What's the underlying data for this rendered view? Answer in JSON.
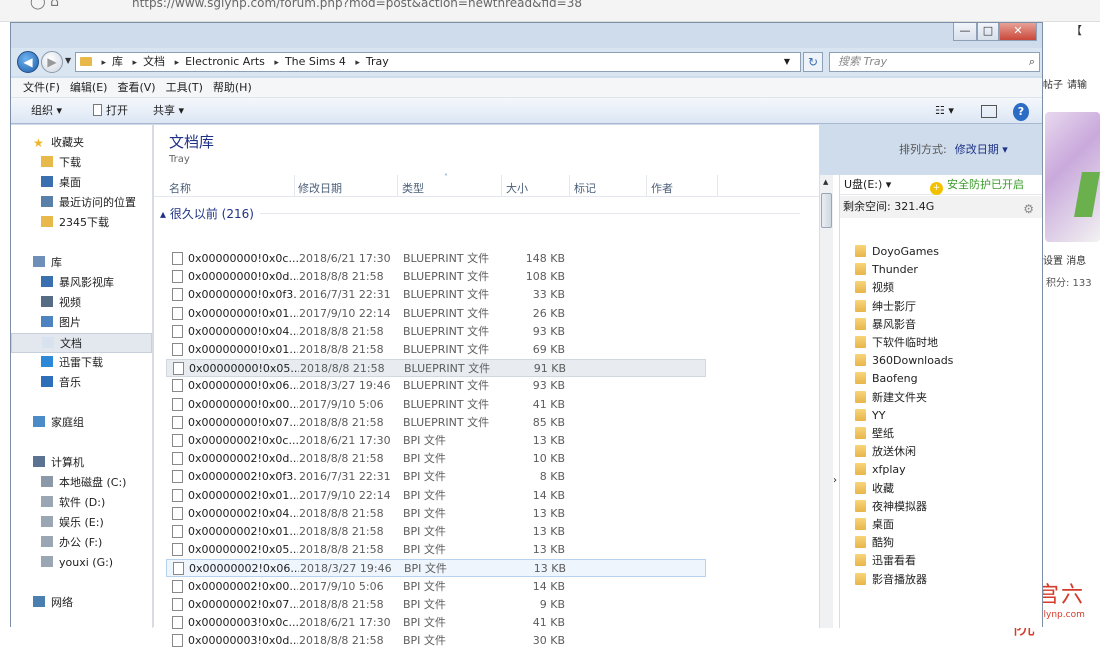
{
  "browser": {
    "url": "https://www.sglynp.com/forum.php?mod=post&action=newthread&fid=38"
  },
  "background_page": {
    "top_right": "【",
    "right_tabs": [
      "帖子",
      "请输"
    ],
    "links": [
      "设置",
      "消息"
    ],
    "points": "积分: 133"
  },
  "watermark": {
    "title": "三宫六院",
    "url": "www.sglynp.com"
  },
  "window": {
    "minimize": "—",
    "maximize": "□",
    "close": "✕"
  },
  "address": {
    "crumbs": [
      "库",
      "文档",
      "Electronic Arts",
      "The Sims 4",
      "Tray"
    ],
    "search_placeholder": "搜索 Tray"
  },
  "menu": [
    "文件(F)",
    "编辑(E)",
    "查看(V)",
    "工具(T)",
    "帮助(H)"
  ],
  "toolbar": {
    "organize": "组织 ▾",
    "open": "打开",
    "share": "共享 ▾"
  },
  "nav": [
    {
      "label": "收藏夹",
      "icon": "star-icon",
      "kind": "header"
    },
    {
      "label": "下载",
      "icon": "download-folder-icon",
      "kind": "item"
    },
    {
      "label": "桌面",
      "icon": "desktop-icon",
      "kind": "item"
    },
    {
      "label": "最近访问的位置",
      "icon": "recent-places-icon",
      "kind": "item"
    },
    {
      "label": "2345下载",
      "icon": "folder-icon",
      "kind": "item"
    },
    {
      "label": "库",
      "icon": "library-icon",
      "kind": "header"
    },
    {
      "label": "暴风影视库",
      "icon": "video-library-icon",
      "kind": "item"
    },
    {
      "label": "视频",
      "icon": "video-icon",
      "kind": "item"
    },
    {
      "label": "图片",
      "icon": "pictures-icon",
      "kind": "item"
    },
    {
      "label": "文档",
      "icon": "documents-icon",
      "kind": "item"
    },
    {
      "label": "迅雷下载",
      "icon": "thunder-icon",
      "kind": "item"
    },
    {
      "label": "音乐",
      "icon": "music-icon",
      "kind": "item"
    },
    {
      "label": "家庭组",
      "icon": "homegroup-icon",
      "kind": "header"
    },
    {
      "label": "计算机",
      "icon": "computer-icon",
      "kind": "header"
    },
    {
      "label": "本地磁盘 (C:)",
      "icon": "drive-c-icon",
      "kind": "item"
    },
    {
      "label": "软件 (D:)",
      "icon": "drive-icon",
      "kind": "item"
    },
    {
      "label": "娱乐 (E:)",
      "icon": "drive-icon",
      "kind": "item"
    },
    {
      "label": "办公 (F:)",
      "icon": "drive-icon",
      "kind": "item"
    },
    {
      "label": "youxi (G:)",
      "icon": "drive-icon",
      "kind": "item"
    },
    {
      "label": "网络",
      "icon": "network-icon",
      "kind": "header"
    }
  ],
  "library": {
    "title": "文档库",
    "subtitle": "Tray",
    "sort_label": "排列方式:",
    "sort_value": "修改日期 ▾"
  },
  "columns": [
    "名称",
    "修改日期",
    "类型",
    "大小",
    "标记",
    "作者"
  ],
  "group": "▴ 很久以前 (216)",
  "files": [
    {
      "name": "0x00000000!0x0c...",
      "date": "2018/6/21 17:30",
      "type": "BLUEPRINT 文件",
      "size": "148 KB"
    },
    {
      "name": "0x00000000!0x0d...",
      "date": "2018/8/8 21:58",
      "type": "BLUEPRINT 文件",
      "size": "108 KB"
    },
    {
      "name": "0x00000000!0x0f3...",
      "date": "2016/7/31 22:31",
      "type": "BLUEPRINT 文件",
      "size": "33 KB"
    },
    {
      "name": "0x00000000!0x01...",
      "date": "2017/9/10 22:14",
      "type": "BLUEPRINT 文件",
      "size": "26 KB"
    },
    {
      "name": "0x00000000!0x04...",
      "date": "2018/8/8 21:58",
      "type": "BLUEPRINT 文件",
      "size": "93 KB"
    },
    {
      "name": "0x00000000!0x01...",
      "date": "2018/8/8 21:58",
      "type": "BLUEPRINT 文件",
      "size": "69 KB"
    },
    {
      "name": "0x00000000!0x05...",
      "date": "2018/8/8 21:58",
      "type": "BLUEPRINT 文件",
      "size": "91 KB"
    },
    {
      "name": "0x00000000!0x06...",
      "date": "2018/3/27 19:46",
      "type": "BLUEPRINT 文件",
      "size": "93 KB"
    },
    {
      "name": "0x00000000!0x00...",
      "date": "2017/9/10 5:06",
      "type": "BLUEPRINT 文件",
      "size": "41 KB"
    },
    {
      "name": "0x00000000!0x07...",
      "date": "2018/8/8 21:58",
      "type": "BLUEPRINT 文件",
      "size": "85 KB"
    },
    {
      "name": "0x00000002!0x0c...",
      "date": "2018/6/21 17:30",
      "type": "BPI 文件",
      "size": "13 KB"
    },
    {
      "name": "0x00000002!0x0d...",
      "date": "2018/8/8 21:58",
      "type": "BPI 文件",
      "size": "10 KB"
    },
    {
      "name": "0x00000002!0x0f3...",
      "date": "2016/7/31 22:31",
      "type": "BPI 文件",
      "size": "8 KB"
    },
    {
      "name": "0x00000002!0x01...",
      "date": "2017/9/10 22:14",
      "type": "BPI 文件",
      "size": "14 KB"
    },
    {
      "name": "0x00000002!0x04...",
      "date": "2018/8/8 21:58",
      "type": "BPI 文件",
      "size": "13 KB"
    },
    {
      "name": "0x00000002!0x01...",
      "date": "2018/8/8 21:58",
      "type": "BPI 文件",
      "size": "13 KB"
    },
    {
      "name": "0x00000002!0x05...",
      "date": "2018/8/8 21:58",
      "type": "BPI 文件",
      "size": "13 KB"
    },
    {
      "name": "0x00000002!0x06...",
      "date": "2018/3/27 19:46",
      "type": "BPI 文件",
      "size": "13 KB"
    },
    {
      "name": "0x00000002!0x00...",
      "date": "2017/9/10 5:06",
      "type": "BPI 文件",
      "size": "14 KB"
    },
    {
      "name": "0x00000002!0x07...",
      "date": "2018/8/8 21:58",
      "type": "BPI 文件",
      "size": "9 KB"
    },
    {
      "name": "0x00000003!0x0c...",
      "date": "2018/6/21 17:30",
      "type": "BPI 文件",
      "size": "41 KB"
    },
    {
      "name": "0x00000003!0x0d...",
      "date": "2018/8/8 21:58",
      "type": "BPI 文件",
      "size": "30 KB"
    }
  ],
  "usb": {
    "drive": "U盘(E:) ▾",
    "protection": "安全防护已开启",
    "free_space": "剩余空间: 321.4G",
    "folders": [
      "DoyoGames",
      "Thunder",
      "视频",
      "绅士影厅",
      "暴风影音",
      "下软件临时地",
      "360Downloads",
      "Baofeng",
      "新建文件夹",
      "YY",
      "壁纸",
      "放送休闲",
      "xfplay",
      "收藏",
      "夜神模拟器",
      "桌面",
      "酷狗",
      "迅雷看看",
      "影音播放器"
    ]
  }
}
